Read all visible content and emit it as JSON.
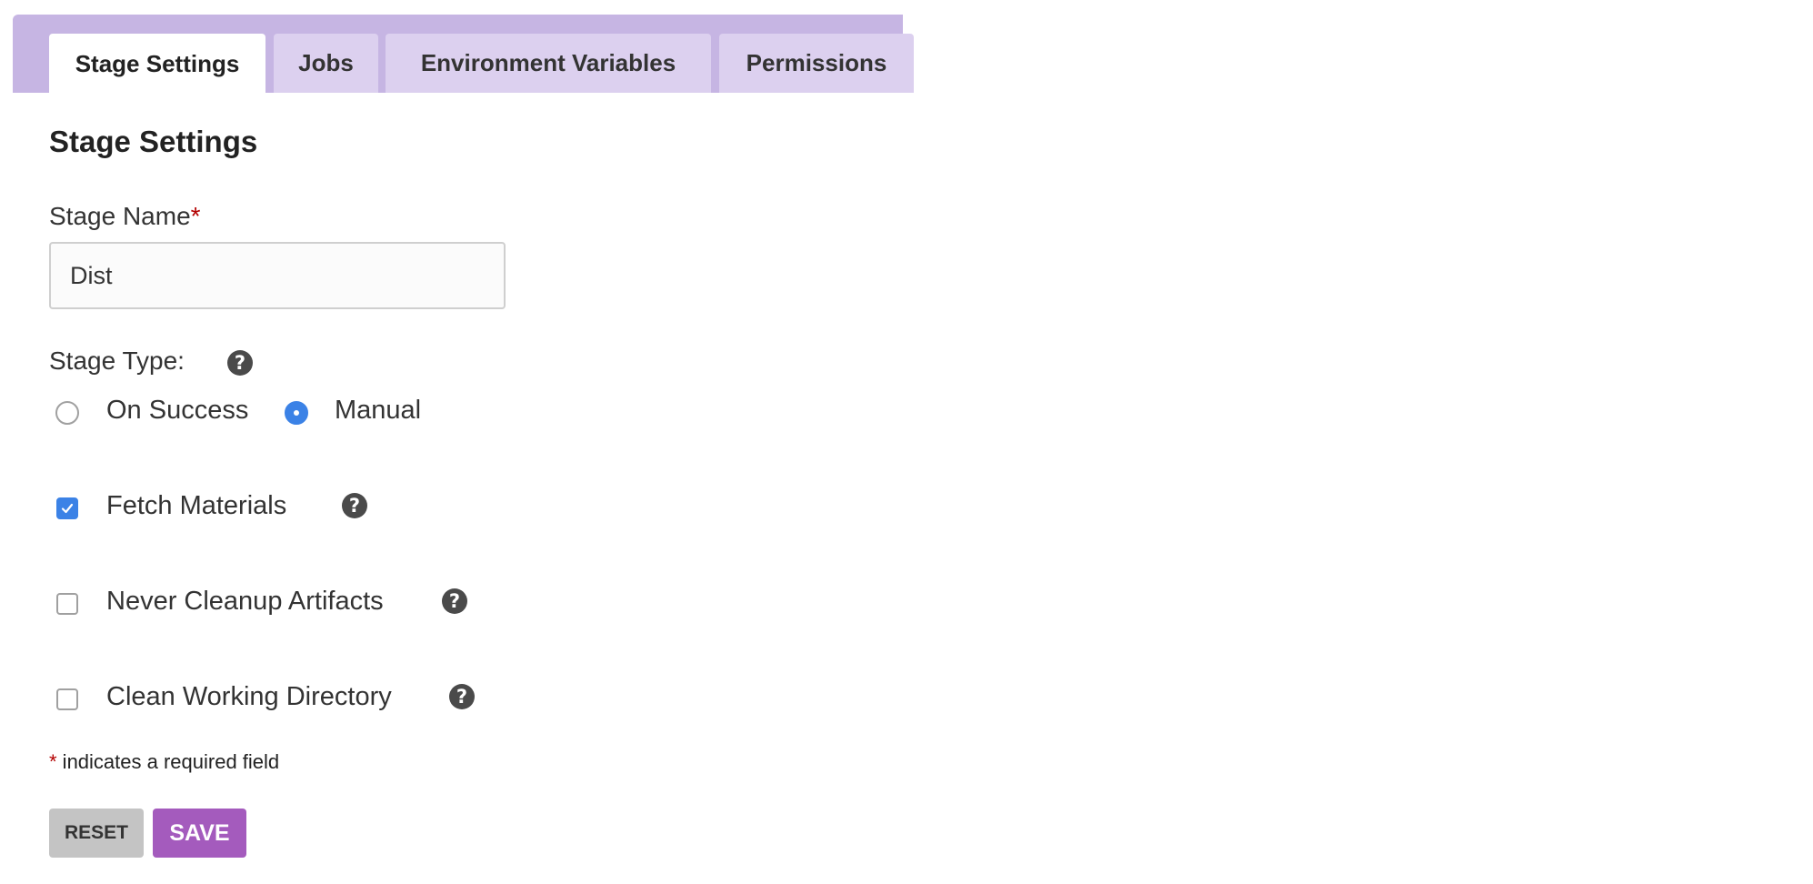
{
  "tabs": [
    {
      "label": "Stage Settings",
      "active": true
    },
    {
      "label": "Jobs",
      "active": false
    },
    {
      "label": "Environment Variables",
      "active": false
    },
    {
      "label": "Permissions",
      "active": false
    }
  ],
  "section_title": "Stage Settings",
  "stage_name": {
    "label": "Stage Name",
    "required_marker": "*",
    "value": "Dist"
  },
  "stage_type": {
    "label": "Stage Type:",
    "options": [
      {
        "label": "On Success",
        "selected": false
      },
      {
        "label": "Manual",
        "selected": true
      }
    ]
  },
  "checkboxes": [
    {
      "label": "Fetch Materials",
      "checked": true
    },
    {
      "label": "Never Cleanup Artifacts",
      "checked": false
    },
    {
      "label": "Clean Working Directory",
      "checked": false
    }
  ],
  "help_icon_glyph": "?",
  "required_note": {
    "marker": "*",
    "text": " indicates a required field"
  },
  "buttons": {
    "reset_label": "RESET",
    "save_label": "SAVE"
  },
  "colors": {
    "tab_bar": "#c6b5e3",
    "tab_inactive": "#dcd0ef",
    "accent_blue": "#3b82e6",
    "save_button": "#a45bbd",
    "reset_button": "#c4c4c4",
    "required": "#b30000"
  },
  "icons": {
    "help": "question-circle-icon",
    "check": "check-icon"
  }
}
